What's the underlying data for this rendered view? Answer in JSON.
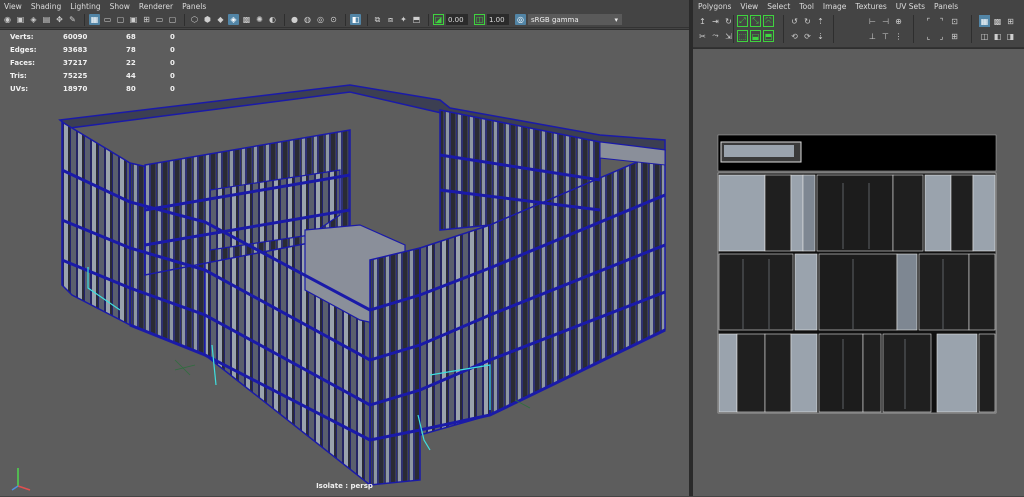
{
  "viewport_menu": [
    "View",
    "Shading",
    "Lighting",
    "Show",
    "Renderer",
    "Panels"
  ],
  "viewport_toolbar": {
    "exposure_value": "0.00",
    "gamma_value": "1.00",
    "color_space": "sRGB gamma"
  },
  "hud": {
    "rows": [
      {
        "label": "Verts:",
        "v1": "60090",
        "v2": "68",
        "v3": "0"
      },
      {
        "label": "Edges:",
        "v1": "93683",
        "v2": "78",
        "v3": "0"
      },
      {
        "label": "Faces:",
        "v1": "37217",
        "v2": "22",
        "v3": "0"
      },
      {
        "label": "Tris:",
        "v1": "75225",
        "v2": "44",
        "v3": "0"
      },
      {
        "label": "UVs:",
        "v1": "18970",
        "v2": "80",
        "v3": "0"
      }
    ]
  },
  "camera_label": "Isolate : persp",
  "uv_menu": [
    "Polygons",
    "View",
    "Select",
    "Tool",
    "Image",
    "Textures",
    "UV Sets",
    "Panels"
  ],
  "colors": {
    "wire": "#1a1aa8",
    "selected_edge": "#3fdede",
    "face_light": "#9aa3ad",
    "face_dark": "#1e1e1e",
    "viewport_bg": "#5d5d5d"
  }
}
